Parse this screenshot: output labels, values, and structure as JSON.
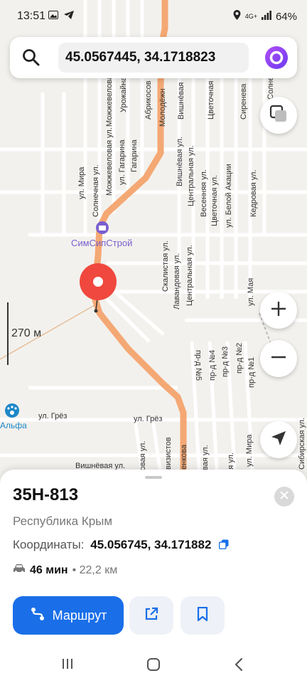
{
  "status_bar": {
    "time": "13:51",
    "left_icons": [
      "gallery-icon",
      "telegram-icon"
    ],
    "network": "4G+",
    "battery": "64%"
  },
  "search": {
    "value": "45.0567445, 34.1718823"
  },
  "map": {
    "scale_label": "270 м",
    "streets": {
      "top_rotated": [
        "Можжевеловая ул.",
        "Урожайная",
        "Абрикосов",
        "Молодёжн",
        "Вишнёвая",
        "Цветочная",
        "Сиренева",
        "Солнечна"
      ],
      "mid_rotated": [
        "ул. Мира",
        "Солнечная ул.",
        "Можжевеловая ул.",
        "ул. Гагарина",
        "Гагарина",
        "Вишнёвая ул.",
        "Центральная ул.",
        "Весенняя ул.",
        "Цветочная ул.",
        "ул. Белой Акации",
        "Кедровая ул."
      ],
      "center_rotated": [
        "Скалистая ул.",
        "Лавандовая ул.",
        "Центральная ул."
      ],
      "lanes": [
        "пр-д №5",
        "пр-д №4",
        "пр-д №3",
        "пр-д №2",
        "пр-д №1"
      ],
      "bottom": [
        "ул. Грёз",
        "ул. Грёз",
        "Вишнёвая ул."
      ],
      "bottom_rotated": [
        "андовая ул.",
        "визистов",
        "енкова",
        "товая ул.",
        "ная ул.",
        "ул. Мира",
        "Сибирская ул."
      ],
      "right_rotated": [
        "ул. Мая"
      ]
    },
    "pois": {
      "store": "СимСипСтрой",
      "vet": "Альфа"
    },
    "colors": {
      "route": "#f4a874",
      "pin": "#f0483e",
      "poi_store": "#7a5fd0",
      "poi_vet": "#1e88c9"
    }
  },
  "sheet": {
    "title": "35Н-813",
    "region": "Республика Крым",
    "coords_label": "Координаты:",
    "coords_value": "45.056745, 34.171882",
    "travel_time": "46 мин",
    "travel_distance": "• 22,2 км",
    "route_label": "Маршрут",
    "accent": "#1a6fe8"
  }
}
